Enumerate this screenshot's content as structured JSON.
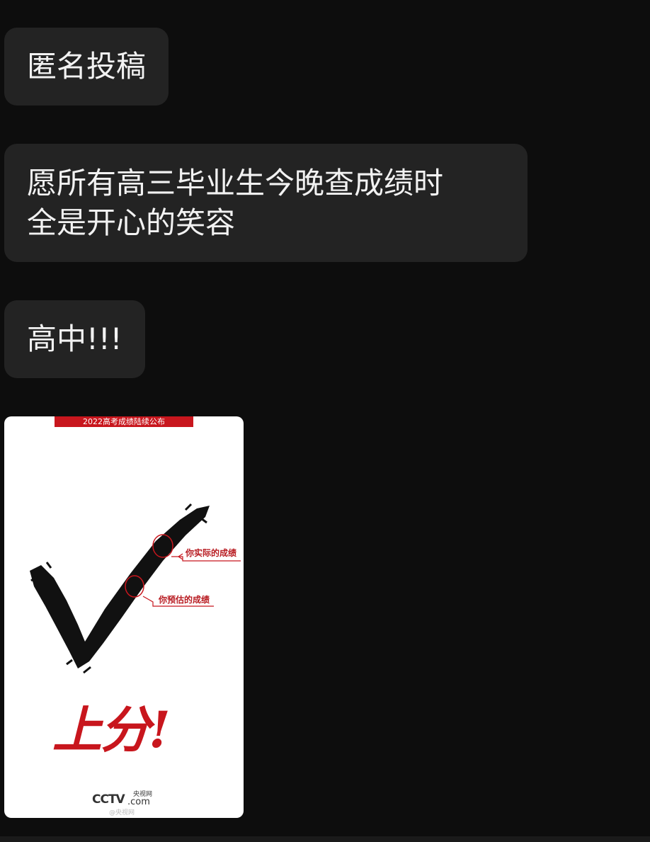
{
  "messages": [
    {
      "text": "匿名投稿"
    },
    {
      "lines": [
        "愿所有高三毕业生今晚查成绩时",
        "全是开心的笑容"
      ]
    },
    {
      "text": "高中!!!"
    }
  ],
  "image": {
    "banner": "2022高考成绩陆续公布",
    "callout_actual": "你实际的成绩",
    "callout_estimated": "你预估的成绩",
    "headline": "上分!",
    "logo_brand": "CCTV",
    "logo_domain": ".com",
    "logo_cn": "央视网",
    "watermark": "@央视网",
    "colors": {
      "accent": "#c8161d",
      "bubble": "#232323",
      "background": "#0d0d0d"
    }
  }
}
